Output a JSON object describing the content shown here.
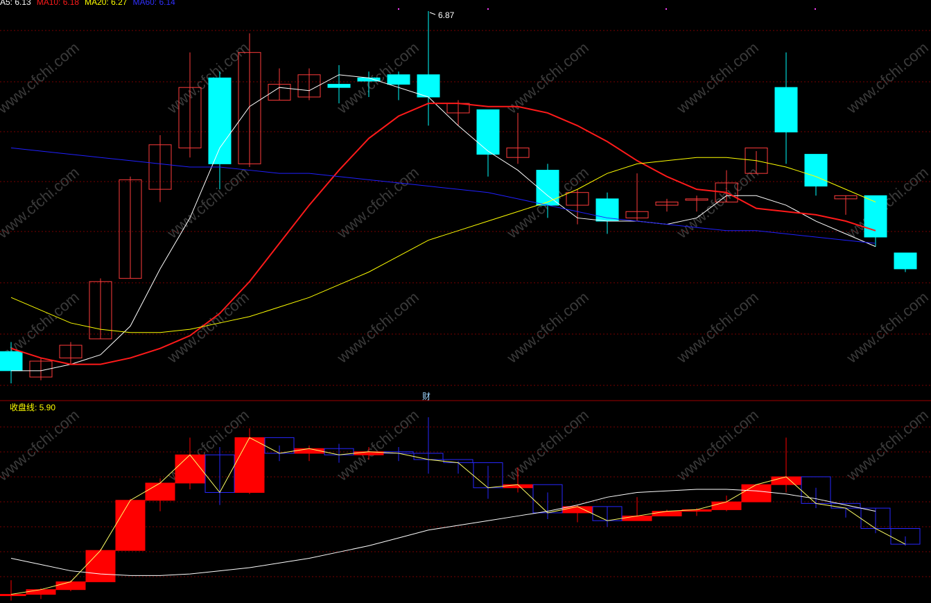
{
  "legend": {
    "ma5": "A5: 6.13",
    "ma10": "MA10: 6.18",
    "ma20": "MA20: 6.27",
    "ma60": "MA60: 6.14"
  },
  "colors": {
    "up": "#ff3b3b",
    "down": "#00ffff",
    "ma5": "#ffffff",
    "ma10": "#ff1a1a",
    "ma20": "#ffff00",
    "ma60": "#2020ff",
    "grid": "#7a0000",
    "divider": "#a00000",
    "sub_up": "#ff0000",
    "sub_down": "#2828ff"
  },
  "peak_label": "6.87",
  "divider_label": "财",
  "sub_legend": "收盘线: 5.90",
  "watermark": "www.cfchi.com",
  "chart_data": [
    {
      "type": "candlestick",
      "title": "",
      "ylim": [
        5.72,
        6.92
      ],
      "series": [
        {
          "name": "MA5",
          "values": [
            5.74,
            5.74,
            5.76,
            5.79,
            5.88,
            6.06,
            6.22,
            6.44,
            6.57,
            6.63,
            6.62,
            6.67,
            6.66,
            6.63,
            6.6,
            6.51,
            6.43,
            6.37,
            6.29,
            6.22,
            6.21,
            6.21,
            6.2,
            6.22,
            6.29,
            6.29,
            6.26,
            6.21,
            6.17,
            6.13
          ]
        },
        {
          "name": "MA10",
          "values": [
            5.81,
            5.78,
            5.76,
            5.76,
            5.78,
            5.81,
            5.85,
            5.92,
            6.02,
            6.14,
            6.26,
            6.37,
            6.47,
            6.54,
            6.58,
            6.58,
            6.57,
            6.57,
            6.55,
            6.51,
            6.46,
            6.4,
            6.35,
            6.31,
            6.3,
            6.25,
            6.24,
            6.23,
            6.21,
            6.18
          ]
        },
        {
          "name": "MA20",
          "values": [
            5.97,
            5.93,
            5.89,
            5.87,
            5.86,
            5.86,
            5.87,
            5.89,
            5.91,
            5.94,
            5.97,
            6.01,
            6.05,
            6.1,
            6.15,
            6.18,
            6.21,
            6.24,
            6.27,
            6.31,
            6.36,
            6.39,
            6.4,
            6.41,
            6.41,
            6.4,
            6.38,
            6.35,
            6.31,
            6.27
          ]
        },
        {
          "name": "MA60",
          "values": [
            6.44,
            6.43,
            6.42,
            6.41,
            6.4,
            6.39,
            6.38,
            6.38,
            6.37,
            6.36,
            6.36,
            6.35,
            6.34,
            6.33,
            6.32,
            6.31,
            6.3,
            6.28,
            6.26,
            6.24,
            6.22,
            6.21,
            6.2,
            6.19,
            6.18,
            6.18,
            6.17,
            6.16,
            6.15,
            6.14
          ]
        }
      ],
      "candles": [
        {
          "o": 5.8,
          "h": 5.83,
          "l": 5.7,
          "c": 5.74
        },
        {
          "o": 5.72,
          "h": 5.78,
          "l": 5.71,
          "c": 5.77
        },
        {
          "o": 5.78,
          "h": 5.83,
          "l": 5.76,
          "c": 5.82
        },
        {
          "o": 5.84,
          "h": 6.03,
          "l": 5.84,
          "c": 6.02
        },
        {
          "o": 6.03,
          "h": 6.35,
          "l": 6.03,
          "c": 6.34
        },
        {
          "o": 6.31,
          "h": 6.48,
          "l": 6.27,
          "c": 6.45
        },
        {
          "o": 6.44,
          "h": 6.74,
          "l": 6.41,
          "c": 6.63
        },
        {
          "o": 6.66,
          "h": 6.68,
          "l": 6.31,
          "c": 6.39
        },
        {
          "o": 6.39,
          "h": 6.8,
          "l": 6.38,
          "c": 6.74
        },
        {
          "o": 6.59,
          "h": 6.69,
          "l": 6.59,
          "c": 6.64
        },
        {
          "o": 6.6,
          "h": 6.69,
          "l": 6.59,
          "c": 6.67
        },
        {
          "o": 6.64,
          "h": 6.7,
          "l": 6.58,
          "c": 6.63
        },
        {
          "o": 6.66,
          "h": 6.68,
          "l": 6.6,
          "c": 6.65
        },
        {
          "o": 6.67,
          "h": 6.68,
          "l": 6.59,
          "c": 6.64
        },
        {
          "o": 6.67,
          "h": 6.87,
          "l": 6.51,
          "c": 6.6
        },
        {
          "o": 6.55,
          "h": 6.59,
          "l": 6.51,
          "c": 6.58
        },
        {
          "o": 6.56,
          "h": 6.56,
          "l": 6.35,
          "c": 6.42
        },
        {
          "o": 6.41,
          "h": 6.55,
          "l": 6.39,
          "c": 6.44
        },
        {
          "o": 6.37,
          "h": 6.39,
          "l": 6.22,
          "c": 6.26
        },
        {
          "o": 6.26,
          "h": 6.31,
          "l": 6.2,
          "c": 6.3
        },
        {
          "o": 6.28,
          "h": 6.3,
          "l": 6.17,
          "c": 6.21
        },
        {
          "o": 6.22,
          "h": 6.36,
          "l": 6.21,
          "c": 6.24
        },
        {
          "o": 6.26,
          "h": 6.28,
          "l": 6.24,
          "c": 6.27
        },
        {
          "o": 6.28,
          "h": 6.29,
          "l": 6.24,
          "c": 6.28
        },
        {
          "o": 6.27,
          "h": 6.37,
          "l": 6.27,
          "c": 6.33
        },
        {
          "o": 6.36,
          "h": 6.43,
          "l": 6.36,
          "c": 6.44
        },
        {
          "o": 6.63,
          "h": 6.74,
          "l": 6.39,
          "c": 6.49
        },
        {
          "o": 6.42,
          "h": 6.42,
          "l": 6.29,
          "c": 6.32
        },
        {
          "o": 6.28,
          "h": 6.29,
          "l": 6.23,
          "c": 6.29
        },
        {
          "o": 6.29,
          "h": 6.29,
          "l": 6.13,
          "c": 6.16
        },
        {
          "o": 6.11,
          "h": 6.11,
          "l": 6.05,
          "c": 6.06
        }
      ]
    },
    {
      "type": "candlestick",
      "title": "",
      "ylim": [
        5.72,
        6.92
      ],
      "series": [
        {
          "name": "收盘线",
          "values": [
            5.74,
            5.77,
            5.82,
            6.02,
            6.34,
            6.45,
            6.63,
            6.39,
            6.74,
            6.64,
            6.67,
            6.63,
            6.65,
            6.64,
            6.6,
            6.58,
            6.42,
            6.44,
            6.26,
            6.3,
            6.21,
            6.24,
            6.27,
            6.28,
            6.33,
            6.44,
            6.49,
            6.32,
            6.29,
            6.16,
            6.06
          ]
        }
      ]
    }
  ]
}
